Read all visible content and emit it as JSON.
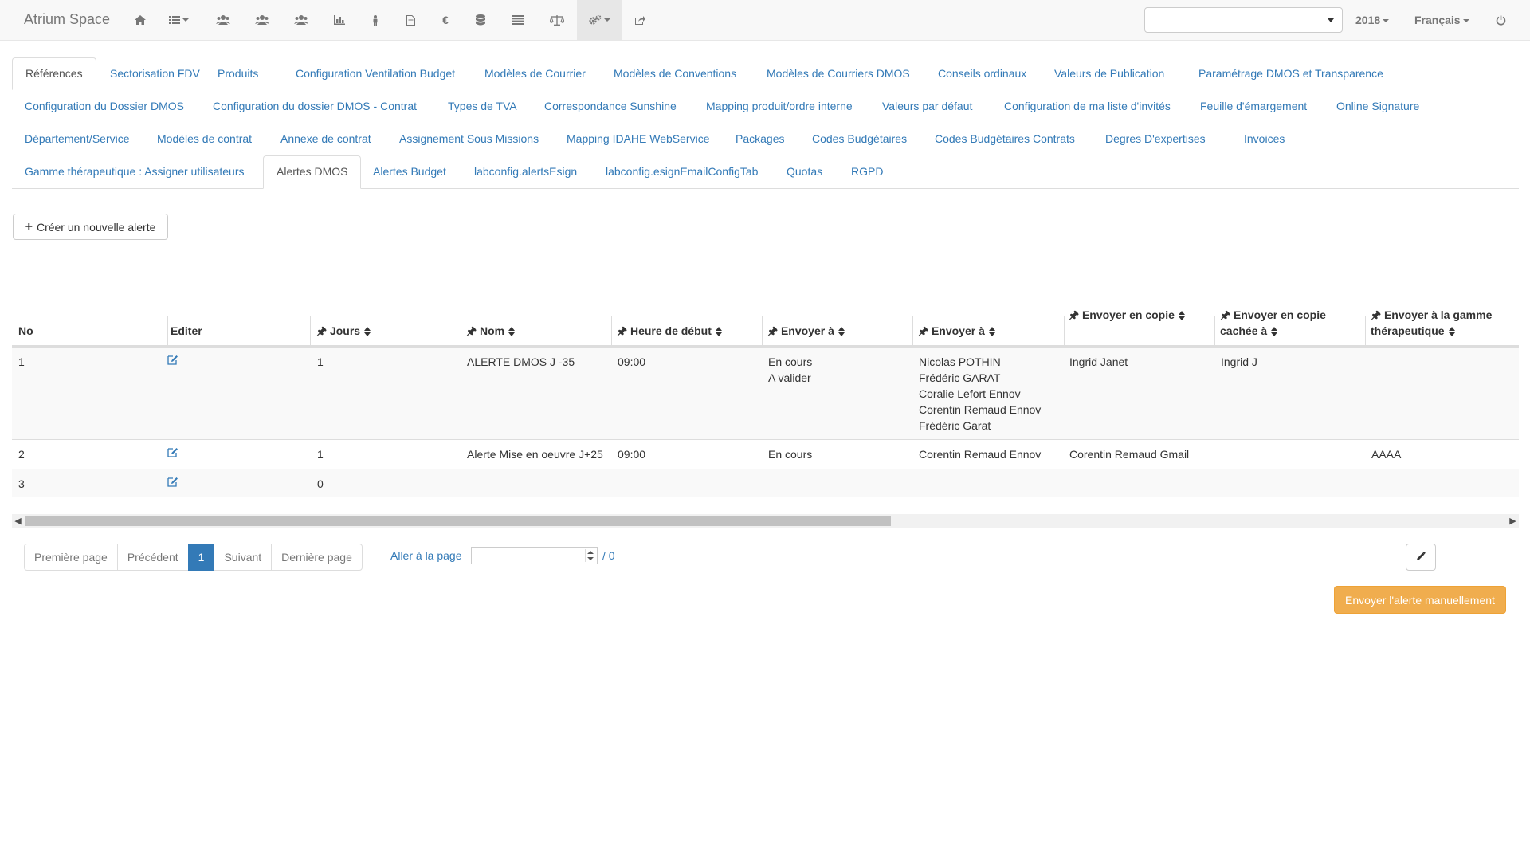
{
  "app": {
    "brand": "Atrium Space"
  },
  "navbar": {
    "icons": [
      "home-icon",
      "list-dropdown-icon",
      "users-icon",
      "users-icon-2",
      "users-icon-3",
      "bar-chart-icon",
      "person-icon",
      "document-icon",
      "euro-icon",
      "database-icon",
      "list-icon",
      "balance-icon",
      "gears-dropdown-icon",
      "share-icon"
    ],
    "euro_symbol": "€",
    "select_value": "",
    "year": "2018",
    "language": "Français"
  },
  "tabs": [
    "Références",
    "Sectorisation FDV",
    "Produits",
    "Configuration Ventilation Budget",
    "Modèles de Courrier",
    "Modèles de Conventions",
    "Modèles de Courriers DMOS",
    "Conseils ordinaux",
    "Valeurs de Publication",
    "Paramétrage DMOS et Transparence",
    "Configuration du Dossier DMOS",
    "Configuration du dossier DMOS - Contrat",
    "Types de TVA",
    "Correspondance Sunshine",
    "Mapping produit/ordre interne",
    "Valeurs par défaut",
    "Configuration de ma liste d'invités",
    "Feuille d'émargement",
    "Online Signature",
    "Département/Service",
    "Modèles de contrat",
    "Annexe de contrat",
    "Assignement Sous Missions",
    "Mapping IDAHE WebService",
    "Packages",
    "Codes Budgétaires",
    "Codes Budgétaires Contrats",
    "Degres D'expertises",
    "Invoices",
    "Gamme thérapeutique : Assigner utilisateurs",
    "Alertes DMOS",
    "Alertes Budget",
    "labconfig.alertsEsign",
    "labconfig.esignEmailConfigTab",
    "Quotas",
    "RGPD"
  ],
  "active_tab": "Alertes DMOS",
  "create_button": "Créer un nouvelle alerte",
  "table": {
    "headers": {
      "no": "No",
      "edit": "Editer",
      "days": "Jours",
      "name": "Nom",
      "start": "Heure de début",
      "send_to_1": "Envoyer à",
      "send_to_2": "Envoyer à",
      "cc_1": "Envoyer en copie",
      "bcc_1": "Envoyer en copie",
      "bcc_2": "cachée à",
      "range_1": "Envoyer à la gamme",
      "range_2": "thérapeutique"
    },
    "rows": [
      {
        "no": "1",
        "days": "1",
        "name": "ALERTE DMOS J -35",
        "start": "09:00",
        "status": [
          "En cours",
          "A valider"
        ],
        "recipients": [
          "Nicolas POTHIN",
          "Frédéric GARAT",
          "Coralie Lefort Ennov",
          "Corentin Remaud Ennov",
          "Frédéric Garat"
        ],
        "cc": "Ingrid Janet",
        "bcc": "Ingrid J",
        "range": ""
      },
      {
        "no": "2",
        "days": "1",
        "name": "Alerte Mise en oeuvre J+25",
        "start": "09:00",
        "status": [
          "En cours"
        ],
        "recipients": [
          "Corentin Remaud Ennov"
        ],
        "cc": "Corentin Remaud Gmail",
        "bcc": "",
        "range": "AAAA"
      },
      {
        "no": "3",
        "days": "0",
        "name": "",
        "start": "",
        "status": [],
        "recipients": [],
        "cc": "",
        "bcc": "",
        "range": ""
      }
    ]
  },
  "pagination": {
    "first": "Première page",
    "prev": "Précédent",
    "current": "1",
    "next": "Suivant",
    "last": "Dernière page",
    "goto_label": "Aller à la page",
    "goto_value": "",
    "total": "/ 0"
  },
  "send_button": "Envoyer l'alerte manuellement",
  "colors": {
    "link": "#337ab7",
    "warning": "#f0ad4e",
    "navbar_bg": "#f8f8f8"
  }
}
